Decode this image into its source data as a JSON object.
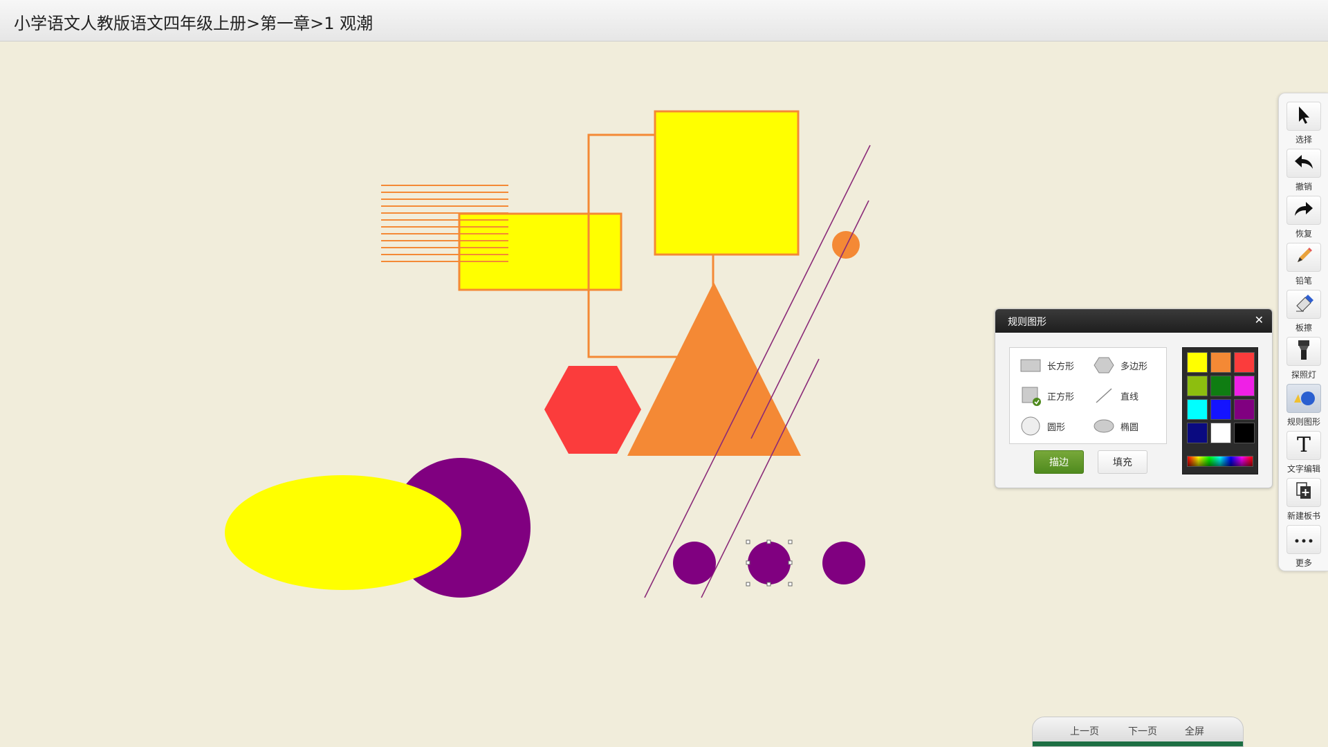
{
  "header": {
    "breadcrumb": "小学语文人教版语文四年级上册>第一章>1 观潮"
  },
  "canvas": {
    "colors": {
      "yellow": "#ffff00",
      "orange": "#f48935",
      "red": "#fb3c3c",
      "purple": "#800080",
      "line_purple": "#8a2a78"
    }
  },
  "toolbar": {
    "items": [
      {
        "label": "选择",
        "icon": "cursor-icon"
      },
      {
        "label": "撤销",
        "icon": "undo-icon"
      },
      {
        "label": "恢复",
        "icon": "redo-icon"
      },
      {
        "label": "铅笔",
        "icon": "pencil-icon"
      },
      {
        "label": "板擦",
        "icon": "eraser-icon"
      },
      {
        "label": "探照灯",
        "icon": "flashlight-icon"
      },
      {
        "label": "规则图形",
        "icon": "shapes-icon"
      },
      {
        "label": "文字编辑",
        "icon": "text-icon"
      },
      {
        "label": "新建板书",
        "icon": "new-board-icon"
      },
      {
        "label": "更多",
        "icon": "more-icon"
      }
    ]
  },
  "panel": {
    "title": "规则图形",
    "shapes": [
      "长方形",
      "多边形",
      "正方形",
      "直线",
      "圆形",
      "椭圆"
    ],
    "selected_shape": "正方形",
    "stroke_label": "描边",
    "fill_label": "填充",
    "palette": [
      "#ffff00",
      "#f48935",
      "#fb3c3c",
      "#8dbe0f",
      "#0f7d12",
      "#ef20e6",
      "#00ffff",
      "#1414ff",
      "#800080",
      "#0a0a80",
      "#ffffff",
      "#000000"
    ]
  },
  "footer": {
    "prev": "上一页",
    "next": "下一页",
    "fullscreen": "全屏"
  }
}
